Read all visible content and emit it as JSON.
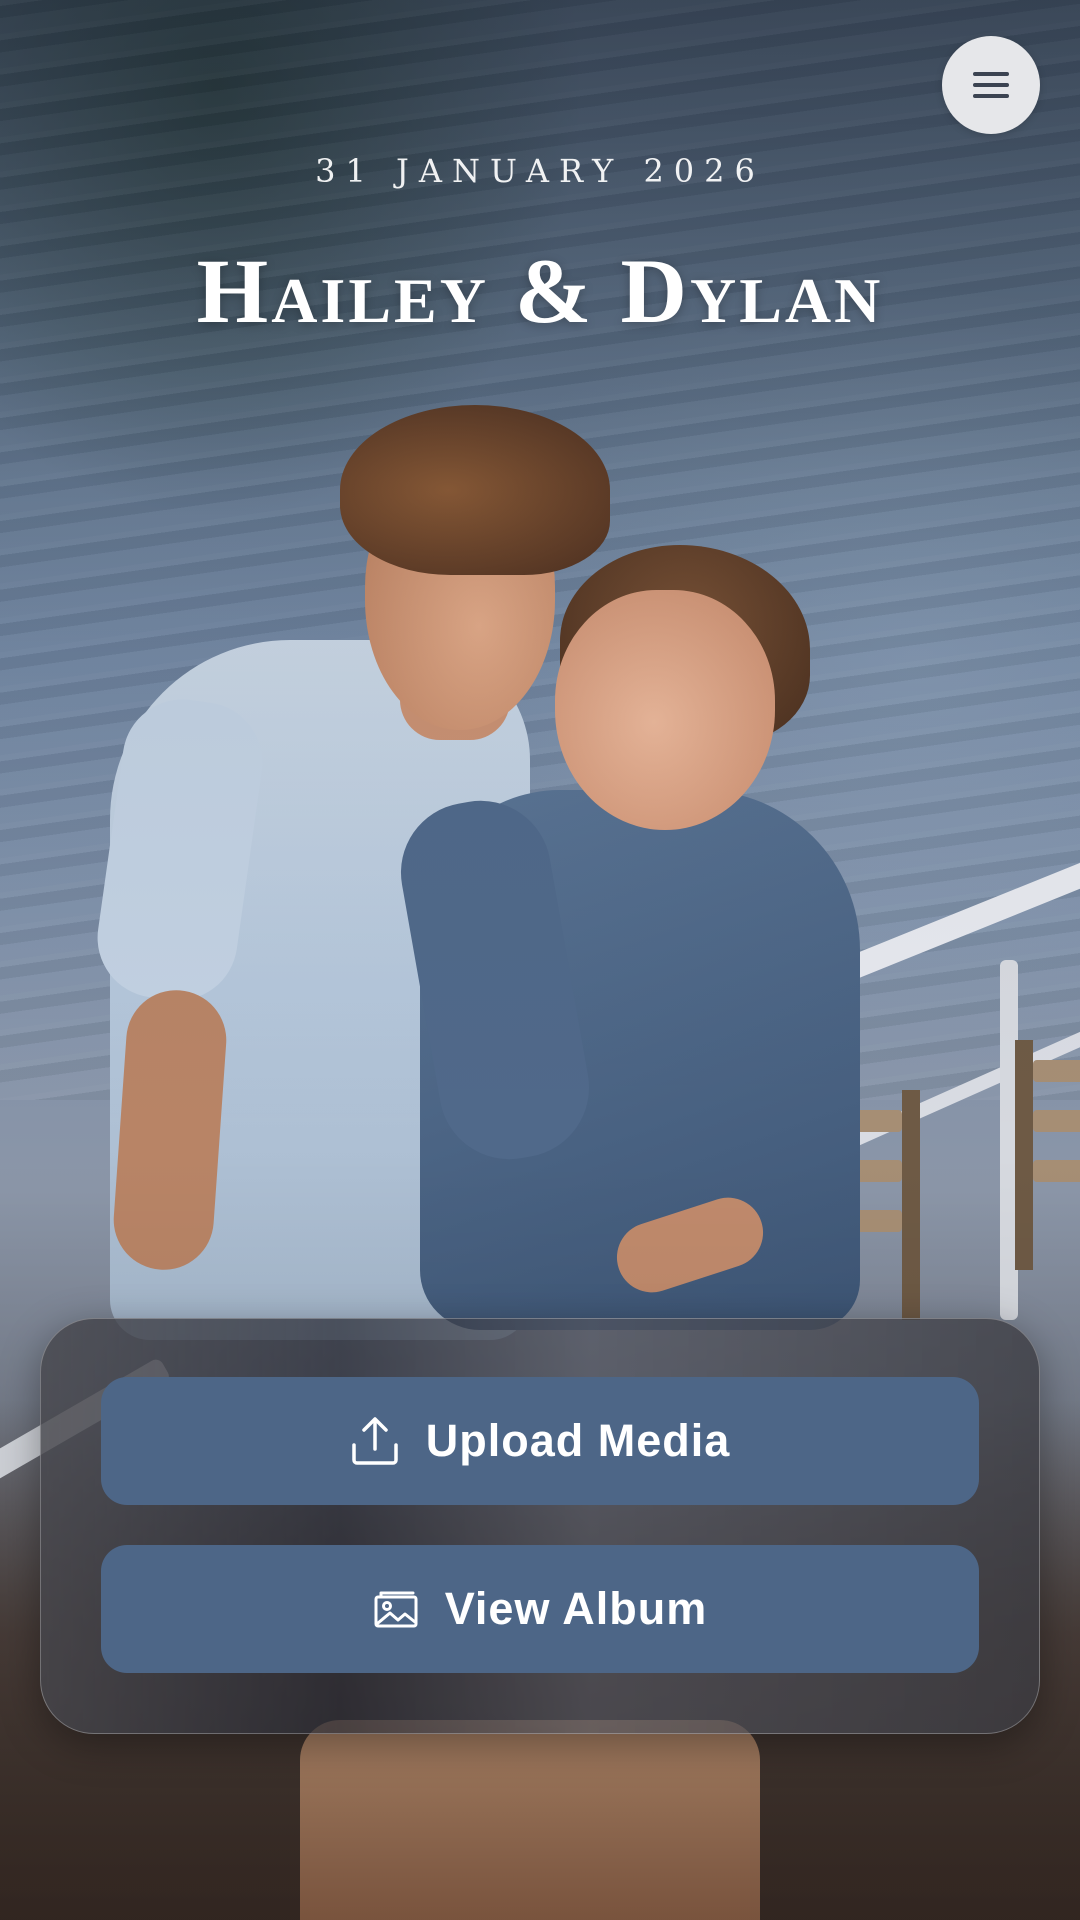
{
  "header": {
    "date": "31 JANUARY 2026",
    "names": "Hailey & Dylan"
  },
  "menu": {
    "icon": "hamburger-menu-icon"
  },
  "actions": {
    "upload": {
      "label": "Upload Media",
      "icon": "upload-icon"
    },
    "album": {
      "label": "View Album",
      "icon": "image-icon"
    }
  },
  "colors": {
    "button_bg": "#4d6687",
    "menu_bg": "#e6e7ea",
    "text": "#ffffff"
  }
}
